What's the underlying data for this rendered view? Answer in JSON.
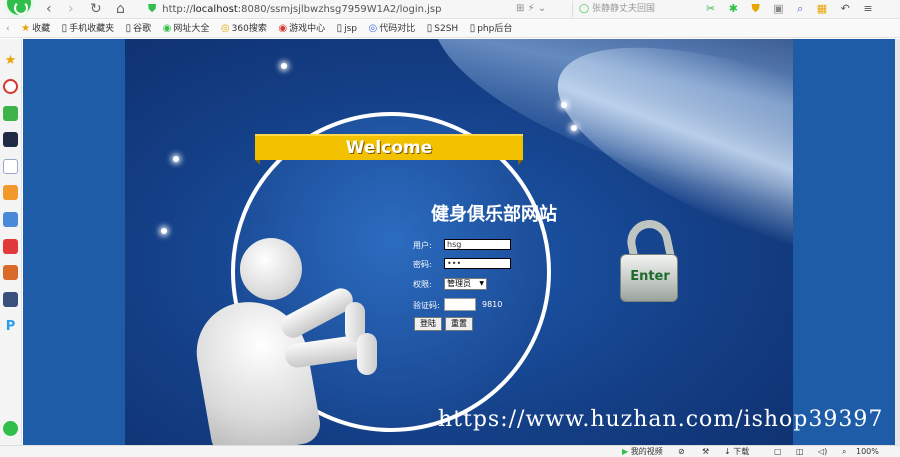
{
  "browser": {
    "url_prefix": "http://",
    "url_host": "localhost",
    "url_rest": ":8080/ssmjsjlbwzhsg7959W1A2/login.jsp",
    "search_hint": "张静静丈夫回国",
    "bookmarks": [
      {
        "icon": "star-icon",
        "glyph": "★",
        "label": "收藏"
      },
      {
        "icon": "mobile-icon",
        "glyph": "▯",
        "label": "手机收藏夹"
      },
      {
        "icon": "page-icon",
        "glyph": "▯",
        "label": "谷歌"
      },
      {
        "icon": "nav-icon",
        "glyph": "◉",
        "label": "网址大全"
      },
      {
        "icon": "search-360-icon",
        "glyph": "◎",
        "label": "360搜索"
      },
      {
        "icon": "game-icon",
        "glyph": "◉",
        "label": "游戏中心"
      },
      {
        "icon": "page-icon",
        "glyph": "▯",
        "label": "jsp"
      },
      {
        "icon": "compare-icon",
        "glyph": "◎",
        "label": "代码对比"
      },
      {
        "icon": "page-icon",
        "glyph": "▯",
        "label": "S2SH"
      },
      {
        "icon": "page-icon",
        "glyph": "▯",
        "label": "php后台"
      }
    ]
  },
  "login": {
    "welcome": "Welcome",
    "site_title": "健身俱乐部网站",
    "username_label": "用户:",
    "username_value": "hsg",
    "password_label": "密码:",
    "password_value": "•••",
    "role_label": "权限:",
    "role_value": "管理员",
    "captcha_label": "验证码:",
    "captcha_code": "9810",
    "login_button": "登陆",
    "reset_button": "重置",
    "enter_label": "Enter"
  },
  "watermark": "https://www.huzhan.com/ishop39397",
  "statusbar": {
    "video": "我的视频",
    "download": "下载",
    "zoom": "100%"
  },
  "colors": {
    "page_bg": "#1e5ca8",
    "ribbon": "#f2c200",
    "lock_text": "#1d6b2a",
    "brand_green": "#2fbf4a"
  }
}
